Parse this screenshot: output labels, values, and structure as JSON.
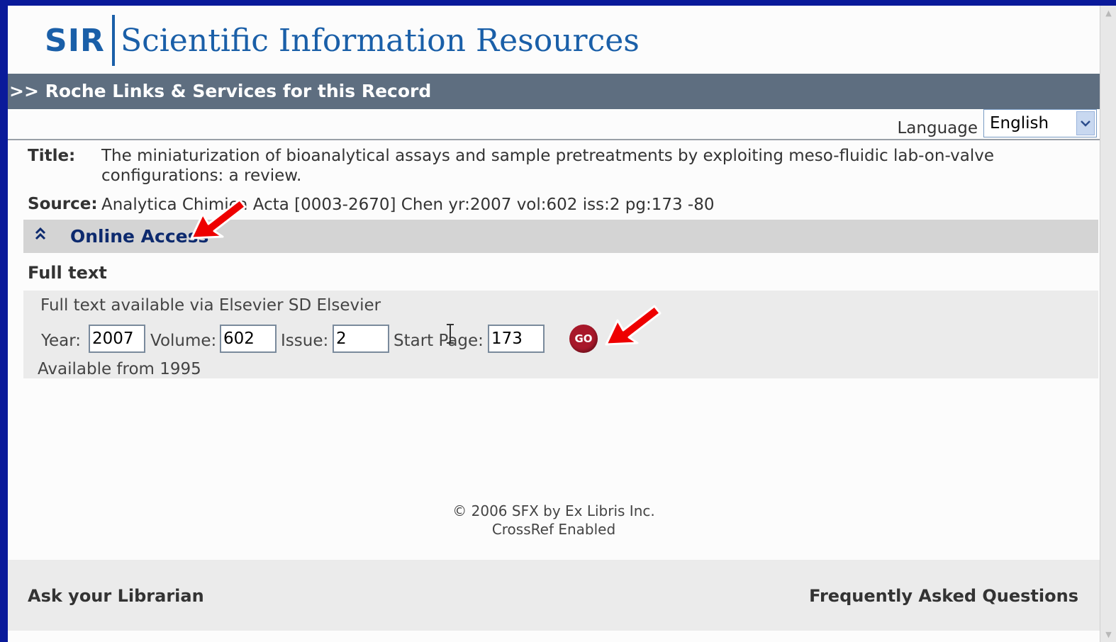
{
  "logo": {
    "short": "SIR",
    "name": "Scientific Information Resources"
  },
  "record_bar": {
    "title": ">> Roche Links & Services for this Record"
  },
  "language": {
    "label": "Language",
    "selected": "English"
  },
  "record": {
    "title_label": "Title:",
    "title_value": "The miniaturization of bioanalytical assays and sample pretreatments by exploiting meso-fluidic lab-on-valve configurations: a review.",
    "source_label": "Source:",
    "source_value": "Analytica Chimica Acta [0003-2670] Chen yr:2007 vol:602 iss:2 pg:173 -80"
  },
  "online_access": {
    "label": "Online Access",
    "icon": "double-chevron-up-icon"
  },
  "full_text": {
    "heading": "Full text",
    "availability": "Full text available via Elsevier SD Elsevier",
    "year_label": "Year:",
    "year_value": "2007",
    "volume_label": "Volume:",
    "volume_value": "602",
    "issue_label": "Issue:",
    "issue_value": "2",
    "start_page_label": "Start Page:",
    "start_page_value": "173",
    "go_label": "GO",
    "available_from": "Available from 1995"
  },
  "footer": {
    "copyright": "© 2006 SFX by Ex Libris Inc.",
    "crossref": "CrossRef Enabled",
    "ask_librarian": "Ask your Librarian",
    "faq": "Frequently Asked Questions"
  },
  "colors": {
    "background": "#0a1a9a",
    "brand_blue": "#1a5fa8",
    "record_bar": "#5e6e80",
    "link_navy": "#0d2a6e",
    "go_button": "#a8182a",
    "annotation_arrow": "#ee0000"
  }
}
